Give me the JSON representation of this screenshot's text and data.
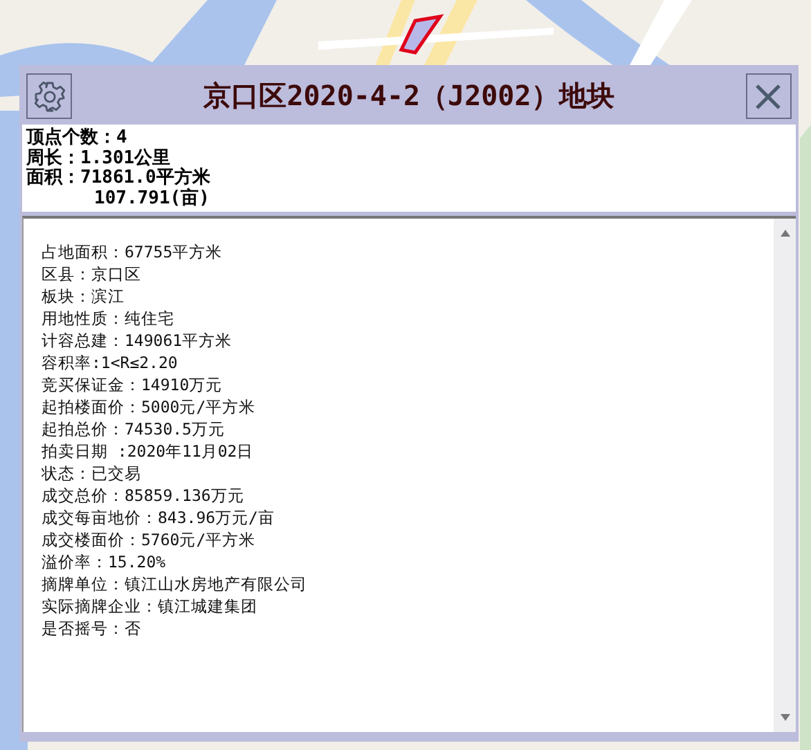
{
  "dialog": {
    "title": "京口区2020-4-2（J2002）地块",
    "summary": [
      {
        "kind": "line",
        "text": "顶点个数：4"
      },
      {
        "kind": "line",
        "text": "周长：1.301公里"
      },
      {
        "kind": "line",
        "text": "面积：71861.0平方米"
      },
      {
        "kind": "continuation",
        "text": "107.791(亩)"
      }
    ],
    "details": [
      "占地面积：67755平方米",
      "区县：京口区",
      "板块：滨江",
      "用地性质：纯住宅",
      "计容总建：149061平方米",
      "容积率:1<R≤2.20",
      "竞买保证金：14910万元",
      "起拍楼面价：5000元/平方米",
      "起拍总价：74530.5万元",
      "拍卖日期 :2020年11月02日",
      "状态：已交易",
      "成交总价：85859.136万元",
      "成交每亩地价：843.96万元/亩",
      "成交楼面价：5760元/平方米",
      "溢价率：15.20%",
      "摘牌单位：镇江山水房地产有限公司",
      "实际摘牌企业：镇江城建集团",
      "是否摇号：否"
    ]
  }
}
